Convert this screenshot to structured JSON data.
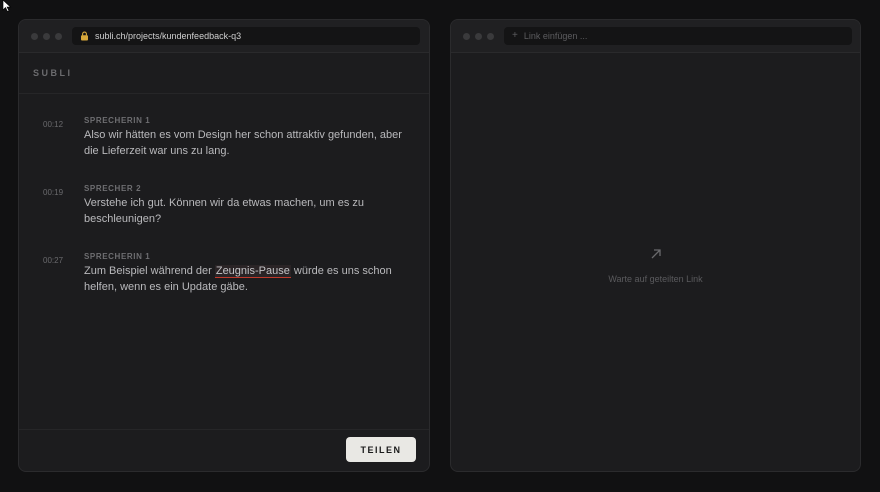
{
  "left_window": {
    "url": "subli.ch/projects/kundenfeedback-q3",
    "brand": "SUBLI",
    "entries": [
      {
        "timestamp": "00:12",
        "speaker": "SPRECHERIN 1",
        "text": "Also wir hätten es vom Design her schon attraktiv gefunden, aber die Lieferzeit war uns zu lang."
      },
      {
        "timestamp": "00:19",
        "speaker": "SPRECHER 2",
        "text": "Verstehe ich gut. Können wir da etwas machen, um es zu beschleunigen?"
      },
      {
        "timestamp": "00:27",
        "speaker": "SPRECHERIN 1",
        "text_before": "Zum Beispiel während der ",
        "highlight": "Zeugnis-Pause",
        "text_after": " würde es uns schon helfen, wenn es ein Update gäbe."
      }
    ],
    "share_label": "TEILEN"
  },
  "right_window": {
    "url_placeholder": "Link einfügen ...",
    "waiting_text": "Warte auf geteilten Link"
  },
  "icons": {
    "lock": "lock-icon",
    "plus": "plus-icon",
    "arrow": "arrow-up-right-icon",
    "cursor": "cursor-icon"
  },
  "colors": {
    "background": "#111112",
    "panel": "#1c1c1e",
    "button": "#e9e8e4",
    "highlight_underline": "#c0392b"
  }
}
